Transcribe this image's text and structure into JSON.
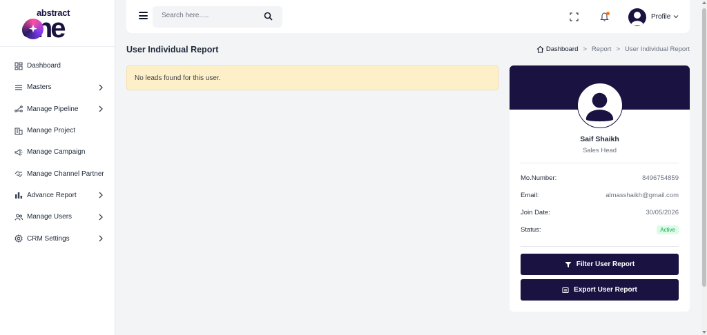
{
  "brand": {
    "small": "abstract",
    "big": "one"
  },
  "sidebar": {
    "items": [
      {
        "label": "Dashboard",
        "icon": "dashboard-icon",
        "has_submenu": false
      },
      {
        "label": "Masters",
        "icon": "list-icon",
        "has_submenu": true
      },
      {
        "label": "Manage Pipeline",
        "icon": "pipeline-icon",
        "has_submenu": true
      },
      {
        "label": "Manage Project",
        "icon": "building-icon",
        "has_submenu": false
      },
      {
        "label": "Manage Campaign",
        "icon": "megaphone-icon",
        "has_submenu": false
      },
      {
        "label": "Manage Channel Partner",
        "icon": "handshake-icon",
        "has_submenu": false
      },
      {
        "label": "Advance Report",
        "icon": "bar-chart-icon",
        "has_submenu": true
      },
      {
        "label": "Manage Users",
        "icon": "users-icon",
        "has_submenu": true
      },
      {
        "label": "CRM Settings",
        "icon": "gear-icon",
        "has_submenu": true
      }
    ]
  },
  "topbar": {
    "search_placeholder": "Search here.....",
    "profile_label": "Profile"
  },
  "page": {
    "title": "User Individual Report",
    "breadcrumb": [
      "Dashboard",
      "Report",
      "User Individual Report"
    ],
    "alert": "No leads found for this user."
  },
  "profile_card": {
    "name": "Saif Shaikh",
    "role": "Sales Head",
    "fields": {
      "mobile_label": "Mo.Number:",
      "mobile_value": "8496754859",
      "email_label": "Email:",
      "email_value": "almasshaikh@gmail.com",
      "join_label": "Join Date:",
      "join_value": "30/05/2026",
      "status_label": "Status:",
      "status_value": "Active"
    },
    "buttons": {
      "filter": "Filter User Report",
      "export": "Export User Report"
    }
  },
  "colors": {
    "brand": "#1a1240",
    "alert_bg": "#fdf0c9",
    "status_active": "#16a34a",
    "notification_dot": "#f97316"
  }
}
